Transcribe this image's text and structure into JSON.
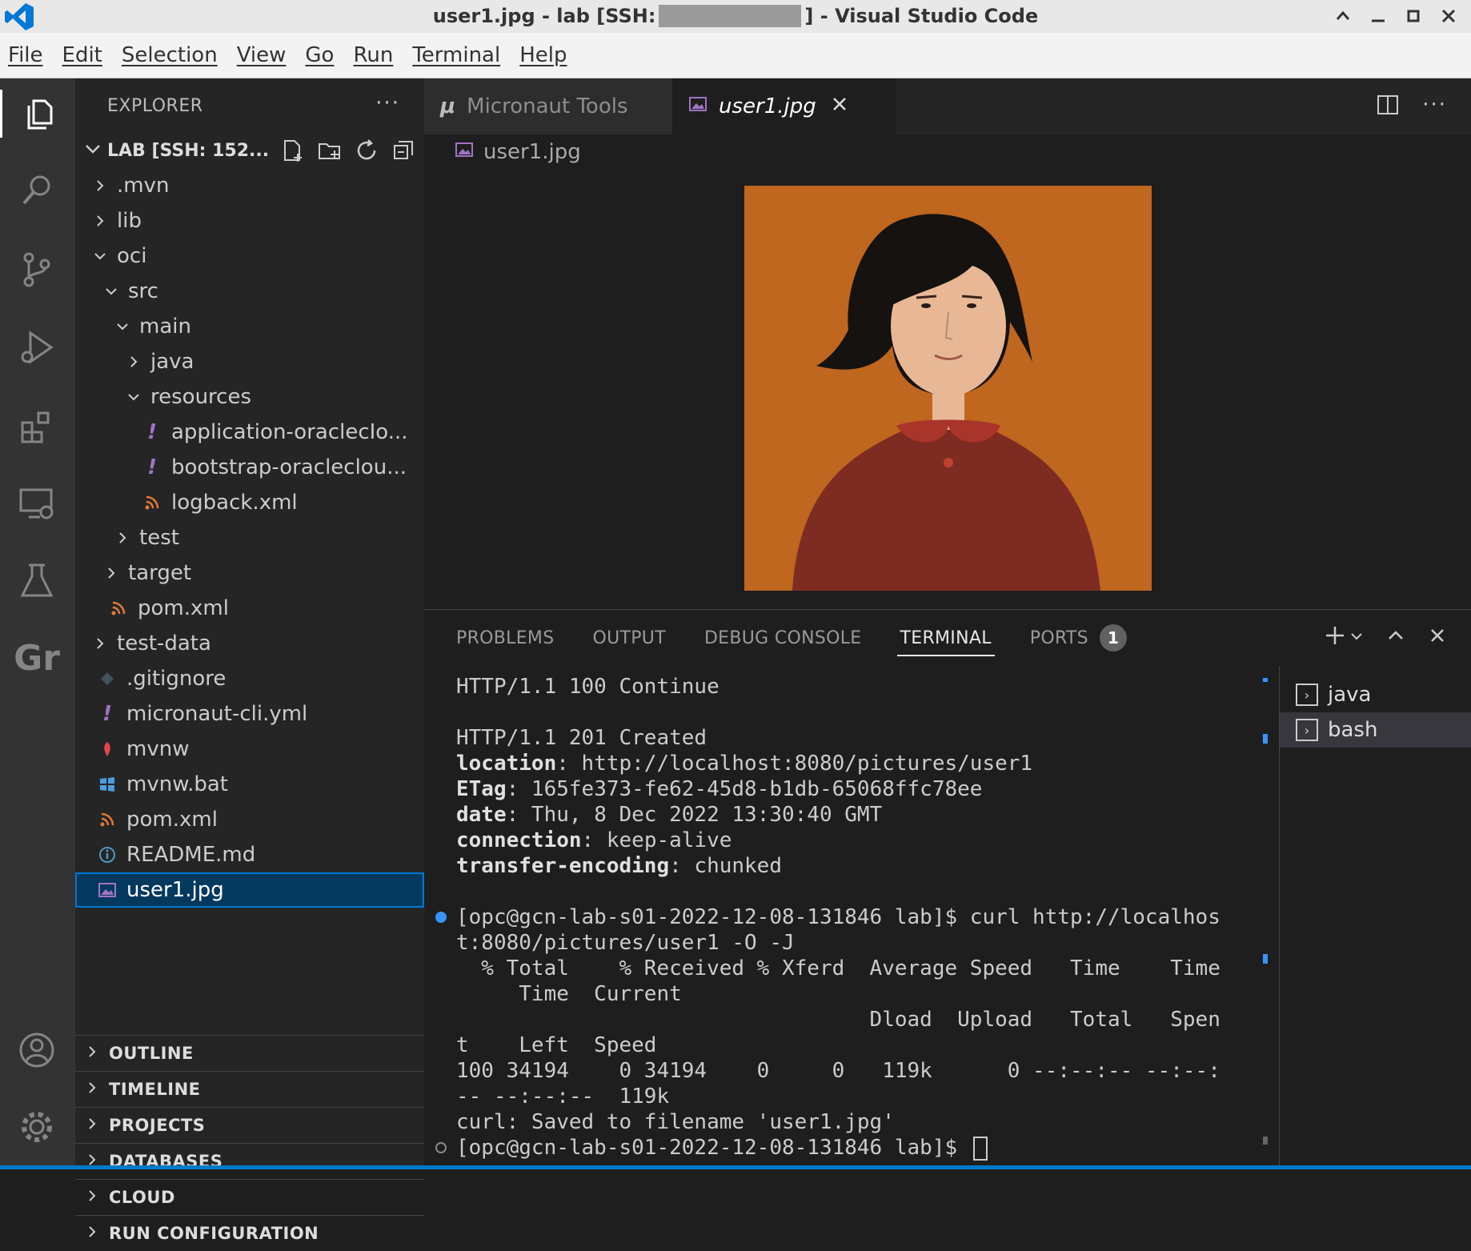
{
  "window": {
    "title_prefix": "user1.jpg - lab [SSH: ",
    "title_suffix": "] - Visual Studio Code"
  },
  "menu": [
    "File",
    "Edit",
    "Selection",
    "View",
    "Go",
    "Run",
    "Terminal",
    "Help"
  ],
  "sidebar": {
    "header": "EXPLORER",
    "root_label": "LAB [SSH: 152...",
    "tree": [
      {
        "label": ".mvn",
        "indent": 1,
        "type": "folder",
        "open": false
      },
      {
        "label": "lib",
        "indent": 1,
        "type": "folder",
        "open": false
      },
      {
        "label": "oci",
        "indent": 1,
        "type": "folder",
        "open": true
      },
      {
        "label": "src",
        "indent": 2,
        "type": "folder",
        "open": true
      },
      {
        "label": "main",
        "indent": 3,
        "type": "folder",
        "open": true
      },
      {
        "label": "java",
        "indent": 4,
        "type": "folder",
        "open": false
      },
      {
        "label": "resources",
        "indent": 4,
        "type": "folder",
        "open": true
      },
      {
        "label": "application-oraclecIo...",
        "indent": 5,
        "type": "yaml"
      },
      {
        "label": "bootstrap-oracleclou...",
        "indent": 5,
        "type": "yaml"
      },
      {
        "label": "logback.xml",
        "indent": 5,
        "type": "xml"
      },
      {
        "label": "test",
        "indent": 3,
        "type": "folder",
        "open": false
      },
      {
        "label": "target",
        "indent": 2,
        "type": "folder",
        "open": false
      },
      {
        "label": "pom.xml",
        "indent": 2,
        "type": "xml"
      },
      {
        "label": "test-data",
        "indent": 1,
        "type": "folder",
        "open": false
      },
      {
        "label": ".gitignore",
        "indent": 1,
        "type": "git"
      },
      {
        "label": "micronaut-cli.yml",
        "indent": 1,
        "type": "yaml"
      },
      {
        "label": "mvnw",
        "indent": 1,
        "type": "shell"
      },
      {
        "label": "mvnw.bat",
        "indent": 1,
        "type": "windows"
      },
      {
        "label": "pom.xml",
        "indent": 1,
        "type": "xml"
      },
      {
        "label": "README.md",
        "indent": 1,
        "type": "info"
      },
      {
        "label": "user1.jpg",
        "indent": 1,
        "type": "image",
        "selected": true
      }
    ],
    "sections": [
      "OUTLINE",
      "TIMELINE",
      "PROJECTS",
      "DATABASES",
      "CLOUD",
      "RUN CONFIGURATION"
    ]
  },
  "editor": {
    "tabs": [
      {
        "label": "Micronaut Tools",
        "active": false
      },
      {
        "label": "user1.jpg",
        "active": true
      }
    ],
    "breadcrumb": "user1.jpg"
  },
  "panel": {
    "tabs": [
      "PROBLEMS",
      "OUTPUT",
      "DEBUG CONSOLE",
      "TERMINAL",
      "PORTS"
    ],
    "active_tab": "TERMINAL",
    "ports_badge": "1",
    "terminal_lines": [
      {
        "text": "HTTP/1.1 100 Continue"
      },
      {
        "text": ""
      },
      {
        "text": "HTTP/1.1 201 Created"
      },
      {
        "key": "location",
        "value": ": http://localhost:8080/pictures/user1"
      },
      {
        "key": "ETag",
        "value": ": 165fe373-fe62-45d8-b1db-65068ffc78ee"
      },
      {
        "key": "date",
        "value": ": Thu, 8 Dec 2022 13:30:40 GMT"
      },
      {
        "key": "connection",
        "value": ": keep-alive"
      },
      {
        "key": "transfer-encoding",
        "value": ": chunked"
      },
      {
        "text": ""
      },
      {
        "text": "[opc@gcn-lab-s01-2022-12-08-131846 lab]$ curl http://localhos",
        "marker": "blue"
      },
      {
        "text": "t:8080/pictures/user1 -O -J"
      },
      {
        "text": "  % Total    % Received % Xferd  Average Speed   Time    Time"
      },
      {
        "text": "     Time  Current"
      },
      {
        "text": "                                 Dload  Upload   Total   Spen"
      },
      {
        "text": "t    Left  Speed"
      },
      {
        "text": "100 34194    0 34194    0     0   119k      0 --:--:-- --:--:"
      },
      {
        "text": "-- --:--:--  119k"
      },
      {
        "text": "curl: Saved to filename 'user1.jpg'"
      },
      {
        "text": "[opc@gcn-lab-s01-2022-12-08-131846 lab]$ ",
        "marker": "hollow",
        "cursor": true
      }
    ],
    "terminal_list": [
      {
        "label": "java",
        "active": false
      },
      {
        "label": "bash",
        "active": true
      }
    ]
  },
  "colors": {
    "accent": "#0078d4",
    "status_bar": "#007acc",
    "image_background": "#c46a22"
  }
}
